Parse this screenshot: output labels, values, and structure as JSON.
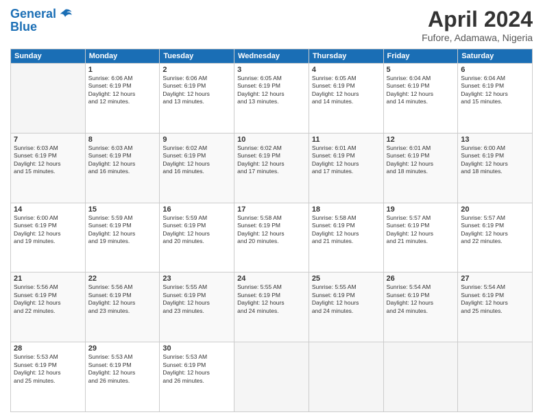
{
  "header": {
    "logo_line1": "General",
    "logo_line2": "Blue",
    "title": "April 2024",
    "subtitle": "Fufore, Adamawa, Nigeria"
  },
  "days_of_week": [
    "Sunday",
    "Monday",
    "Tuesday",
    "Wednesday",
    "Thursday",
    "Friday",
    "Saturday"
  ],
  "weeks": [
    [
      {
        "day": "",
        "info": ""
      },
      {
        "day": "1",
        "info": "Sunrise: 6:06 AM\nSunset: 6:19 PM\nDaylight: 12 hours\nand 12 minutes."
      },
      {
        "day": "2",
        "info": "Sunrise: 6:06 AM\nSunset: 6:19 PM\nDaylight: 12 hours\nand 13 minutes."
      },
      {
        "day": "3",
        "info": "Sunrise: 6:05 AM\nSunset: 6:19 PM\nDaylight: 12 hours\nand 13 minutes."
      },
      {
        "day": "4",
        "info": "Sunrise: 6:05 AM\nSunset: 6:19 PM\nDaylight: 12 hours\nand 14 minutes."
      },
      {
        "day": "5",
        "info": "Sunrise: 6:04 AM\nSunset: 6:19 PM\nDaylight: 12 hours\nand 14 minutes."
      },
      {
        "day": "6",
        "info": "Sunrise: 6:04 AM\nSunset: 6:19 PM\nDaylight: 12 hours\nand 15 minutes."
      }
    ],
    [
      {
        "day": "7",
        "info": "Sunrise: 6:03 AM\nSunset: 6:19 PM\nDaylight: 12 hours\nand 15 minutes."
      },
      {
        "day": "8",
        "info": "Sunrise: 6:03 AM\nSunset: 6:19 PM\nDaylight: 12 hours\nand 16 minutes."
      },
      {
        "day": "9",
        "info": "Sunrise: 6:02 AM\nSunset: 6:19 PM\nDaylight: 12 hours\nand 16 minutes."
      },
      {
        "day": "10",
        "info": "Sunrise: 6:02 AM\nSunset: 6:19 PM\nDaylight: 12 hours\nand 17 minutes."
      },
      {
        "day": "11",
        "info": "Sunrise: 6:01 AM\nSunset: 6:19 PM\nDaylight: 12 hours\nand 17 minutes."
      },
      {
        "day": "12",
        "info": "Sunrise: 6:01 AM\nSunset: 6:19 PM\nDaylight: 12 hours\nand 18 minutes."
      },
      {
        "day": "13",
        "info": "Sunrise: 6:00 AM\nSunset: 6:19 PM\nDaylight: 12 hours\nand 18 minutes."
      }
    ],
    [
      {
        "day": "14",
        "info": "Sunrise: 6:00 AM\nSunset: 6:19 PM\nDaylight: 12 hours\nand 19 minutes."
      },
      {
        "day": "15",
        "info": "Sunrise: 5:59 AM\nSunset: 6:19 PM\nDaylight: 12 hours\nand 19 minutes."
      },
      {
        "day": "16",
        "info": "Sunrise: 5:59 AM\nSunset: 6:19 PM\nDaylight: 12 hours\nand 20 minutes."
      },
      {
        "day": "17",
        "info": "Sunrise: 5:58 AM\nSunset: 6:19 PM\nDaylight: 12 hours\nand 20 minutes."
      },
      {
        "day": "18",
        "info": "Sunrise: 5:58 AM\nSunset: 6:19 PM\nDaylight: 12 hours\nand 21 minutes."
      },
      {
        "day": "19",
        "info": "Sunrise: 5:57 AM\nSunset: 6:19 PM\nDaylight: 12 hours\nand 21 minutes."
      },
      {
        "day": "20",
        "info": "Sunrise: 5:57 AM\nSunset: 6:19 PM\nDaylight: 12 hours\nand 22 minutes."
      }
    ],
    [
      {
        "day": "21",
        "info": "Sunrise: 5:56 AM\nSunset: 6:19 PM\nDaylight: 12 hours\nand 22 minutes."
      },
      {
        "day": "22",
        "info": "Sunrise: 5:56 AM\nSunset: 6:19 PM\nDaylight: 12 hours\nand 23 minutes."
      },
      {
        "day": "23",
        "info": "Sunrise: 5:55 AM\nSunset: 6:19 PM\nDaylight: 12 hours\nand 23 minutes."
      },
      {
        "day": "24",
        "info": "Sunrise: 5:55 AM\nSunset: 6:19 PM\nDaylight: 12 hours\nand 24 minutes."
      },
      {
        "day": "25",
        "info": "Sunrise: 5:55 AM\nSunset: 6:19 PM\nDaylight: 12 hours\nand 24 minutes."
      },
      {
        "day": "26",
        "info": "Sunrise: 5:54 AM\nSunset: 6:19 PM\nDaylight: 12 hours\nand 24 minutes."
      },
      {
        "day": "27",
        "info": "Sunrise: 5:54 AM\nSunset: 6:19 PM\nDaylight: 12 hours\nand 25 minutes."
      }
    ],
    [
      {
        "day": "28",
        "info": "Sunrise: 5:53 AM\nSunset: 6:19 PM\nDaylight: 12 hours\nand 25 minutes."
      },
      {
        "day": "29",
        "info": "Sunrise: 5:53 AM\nSunset: 6:19 PM\nDaylight: 12 hours\nand 26 minutes."
      },
      {
        "day": "30",
        "info": "Sunrise: 5:53 AM\nSunset: 6:19 PM\nDaylight: 12 hours\nand 26 minutes."
      },
      {
        "day": "",
        "info": ""
      },
      {
        "day": "",
        "info": ""
      },
      {
        "day": "",
        "info": ""
      },
      {
        "day": "",
        "info": ""
      }
    ]
  ]
}
